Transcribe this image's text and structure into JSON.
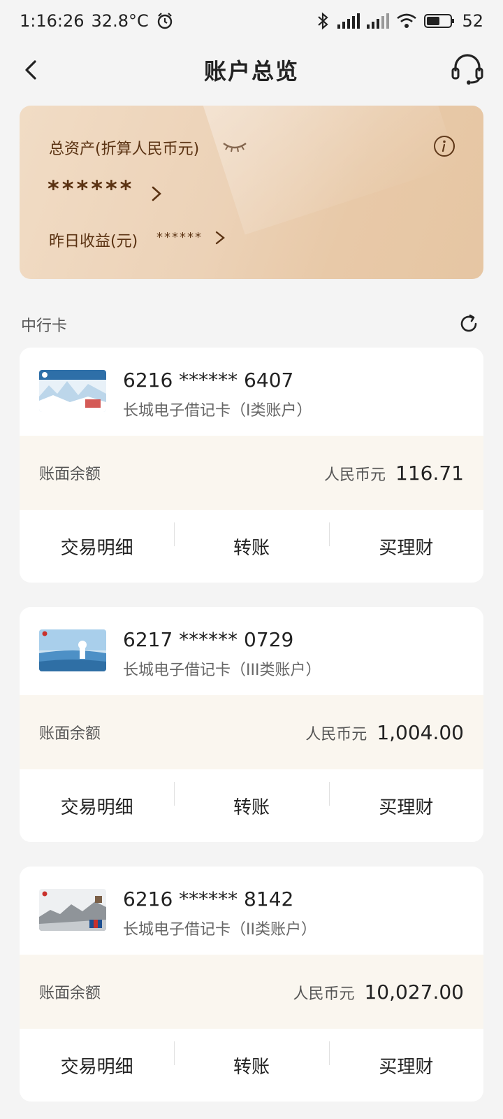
{
  "status_bar": {
    "time": "1:16:26",
    "temperature": "32.8°C",
    "battery": "52"
  },
  "header": {
    "title": "账户总览"
  },
  "assets": {
    "total_label": "总资产(折算人民币元)",
    "total_value": "******",
    "yesterday_label": "昨日收益(元)",
    "yesterday_value": "******"
  },
  "section": {
    "title": "中行卡"
  },
  "cards": [
    {
      "number": "6216 ****** 6407",
      "type": "长城电子借记卡（I类账户）",
      "balance_label": "账面余额",
      "currency": "人民币元",
      "amount": "116.71",
      "actions": [
        "交易明细",
        "转账",
        "买理财"
      ]
    },
    {
      "number": "6217 ****** 0729",
      "type": "长城电子借记卡（III类账户）",
      "balance_label": "账面余额",
      "currency": "人民币元",
      "amount": "1,004.00",
      "actions": [
        "交易明细",
        "转账",
        "买理财"
      ]
    },
    {
      "number": "6216 ****** 8142",
      "type": "长城电子借记卡（II类账户）",
      "balance_label": "账面余额",
      "currency": "人民币元",
      "amount": "10,027.00",
      "actions": [
        "交易明细",
        "转账",
        "买理财"
      ]
    }
  ],
  "colors": {
    "asset_text": "#5a3212",
    "balance_bg": "#faf6ef",
    "page_bg": "#f4f4f4"
  }
}
